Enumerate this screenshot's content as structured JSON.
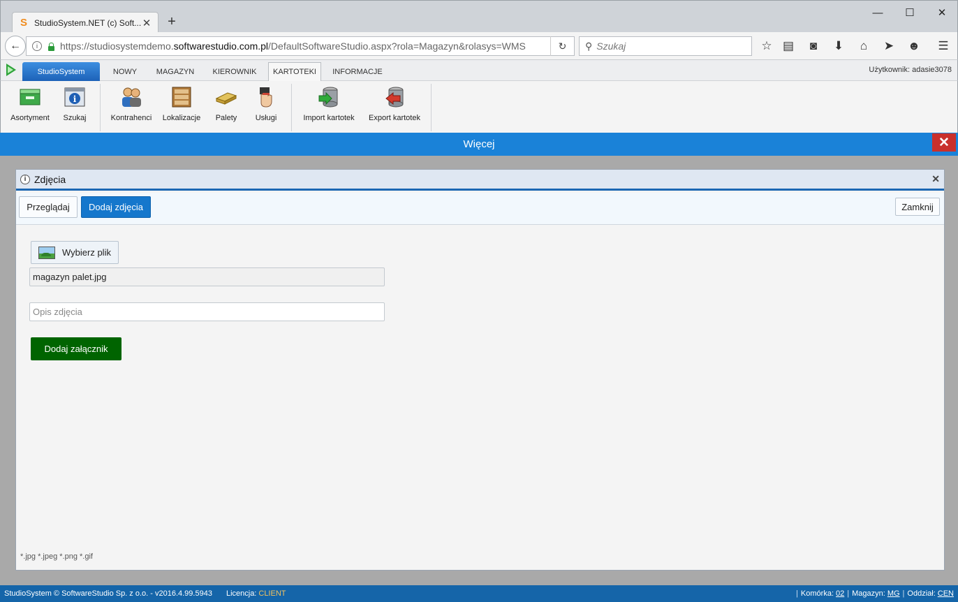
{
  "browser": {
    "tab_title": "StudioSystem.NET (c) Soft...",
    "tab_favicon_letter": "S",
    "url_prefix": "https://studiosystemdemo.",
    "url_domain": "softwarestudio.com.pl",
    "url_suffix": "/DefaultSoftwareStudio.aspx?rola=Magazyn&rolasys=WMS",
    "search_placeholder": "Szukaj"
  },
  "app": {
    "app_button": "StudioSystem",
    "tabs": [
      "NOWY",
      "MAGAZYN",
      "KIEROWNIK",
      "KARTOTEKI",
      "INFORMACJE"
    ],
    "active_tab": "KARTOTEKI",
    "user_label": "Użytkownik: adasie3078"
  },
  "ribbon": {
    "items": [
      "Asortyment",
      "Szukaj",
      "Kontrahenci",
      "Lokalizacje",
      "Palety",
      "Usługi",
      "Import kartotek",
      "Export kartotek"
    ]
  },
  "header": {
    "title": "Więcej"
  },
  "dialog": {
    "title": "Zdjęcia",
    "tab_browse": "Przeglądaj",
    "tab_add": "Dodaj zdjęcia",
    "close_label": "Zamknij",
    "choose_file": "Wybierz plik",
    "file_name": "magazyn palet.jpg",
    "description_placeholder": "Opis zdjęcia",
    "submit": "Dodaj załącznik",
    "extensions": "*.jpg *.jpeg *.png *.gif"
  },
  "footer": {
    "copyright": "StudioSystem © SoftwareStudio Sp. z o.o. - v2016.4.99.5943",
    "license_label": "Licencja:",
    "license_value": "CLIENT",
    "cell_label": "Komórka:",
    "cell_value": "02",
    "warehouse_label": "Magazyn:",
    "warehouse_value": "MG",
    "branch_label": "Oddział:",
    "branch_value": "CEN"
  },
  "colors": {
    "header_blue": "#1a82d8",
    "primary_button": "#1577cc",
    "submit_green": "#006400",
    "footer_blue": "#1565a9",
    "close_red": "#c9302c"
  }
}
